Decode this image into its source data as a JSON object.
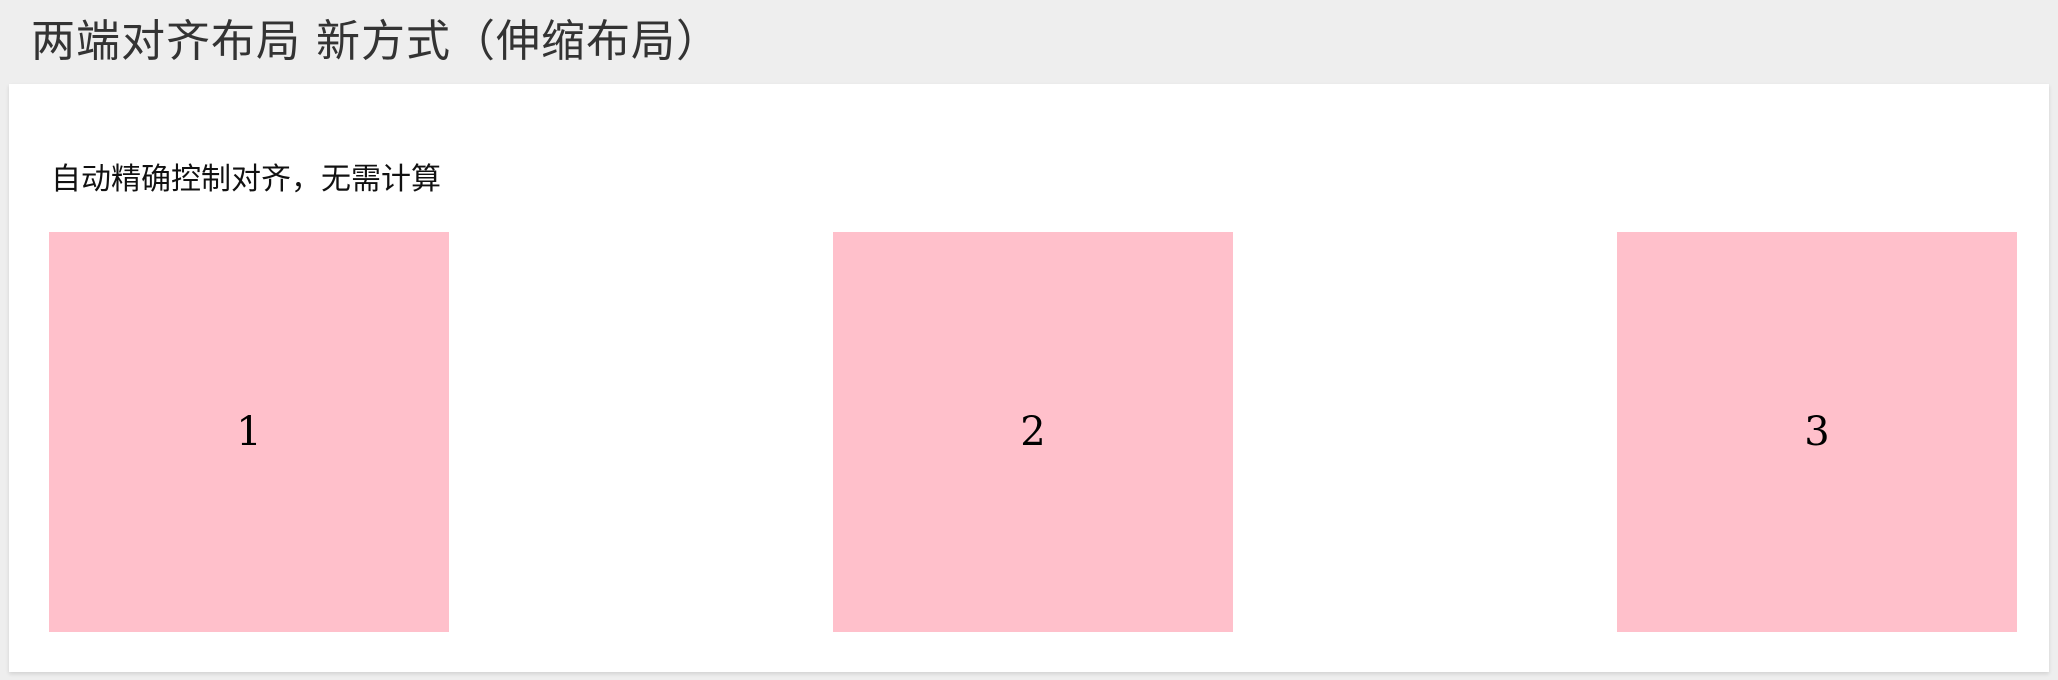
{
  "header": {
    "title": "两端对齐布局 新方式（伸缩布局）"
  },
  "content": {
    "description": "自动精确控制对齐，无需计算",
    "boxes": [
      {
        "label": "1"
      },
      {
        "label": "2"
      },
      {
        "label": "3"
      }
    ]
  },
  "colors": {
    "header_bg": "#eeeeee",
    "panel_bg": "#ffffff",
    "box_bg": "#ffc0cb"
  }
}
